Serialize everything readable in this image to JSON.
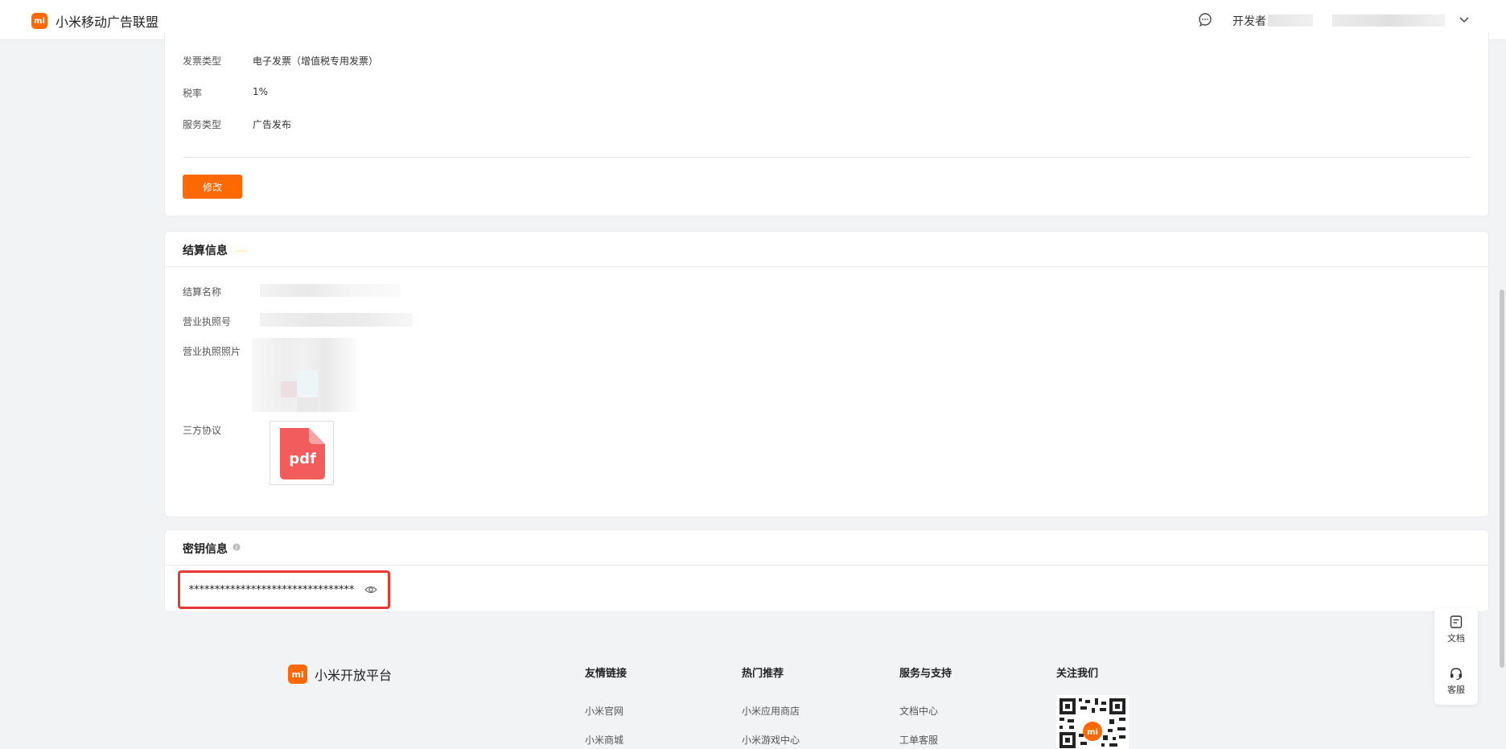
{
  "header": {
    "brand": "小米移动广告联盟",
    "developer_label": "开发者"
  },
  "invoice": {
    "rows": [
      {
        "label": "发票类型",
        "value": "电子发票（增值税专用发票）"
      },
      {
        "label": "税率",
        "value": "1%"
      },
      {
        "label": "服务类型",
        "value": "广告发布"
      }
    ],
    "edit_button": "修改"
  },
  "settlement": {
    "title": "结算信息",
    "fields": {
      "name": "结算名称",
      "license_no": "营业执照号",
      "license_photo": "营业执照照片",
      "agreement": "三方协议"
    },
    "pdf_label": "pdf"
  },
  "secret": {
    "title": "密钥信息",
    "masked_value": "********************************"
  },
  "float_panel": {
    "docs": "文档",
    "service": "客服"
  },
  "footer": {
    "brand": "小米开放平台",
    "columns": [
      {
        "title": "友情链接",
        "links": [
          "小米官网",
          "小米商城"
        ]
      },
      {
        "title": "热门推荐",
        "links": [
          "小米应用商店",
          "小米游戏中心"
        ]
      },
      {
        "title": "服务与支持",
        "links": [
          "文档中心",
          "工单客服"
        ]
      },
      {
        "title": "关注我们",
        "links": []
      }
    ]
  },
  "colors": {
    "brand_orange": "#ff6900",
    "highlight_red": "#e53935",
    "pdf_red": "#f25c5c"
  }
}
